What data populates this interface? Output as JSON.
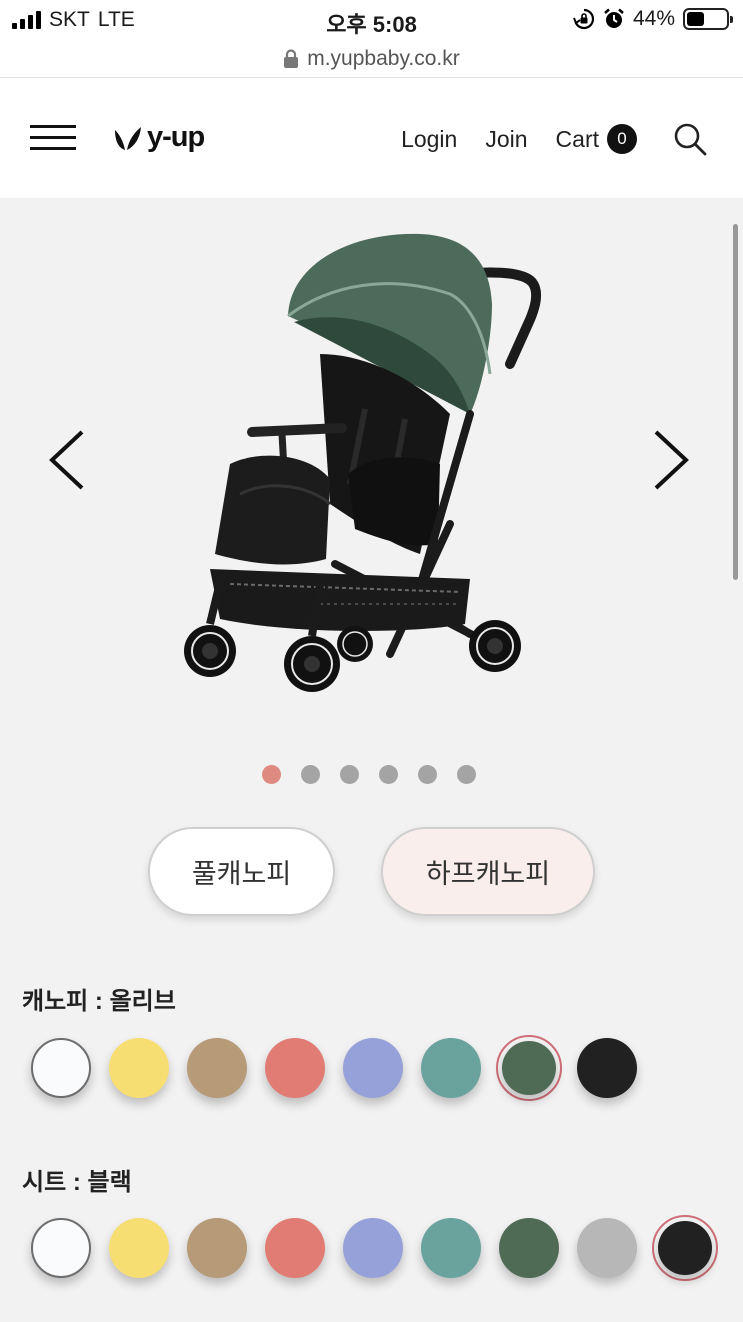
{
  "status_bar": {
    "carrier": "SKT",
    "network": "LTE",
    "time": "오후 5:08",
    "battery": "44%",
    "battery_level": 0.44
  },
  "url_bar": {
    "url": "m.yupbaby.co.kr"
  },
  "header": {
    "logo": "y-up",
    "login": "Login",
    "join": "Join",
    "cart_label": "Cart",
    "cart_count": "0"
  },
  "gallery": {
    "image": "green stroller",
    "slide_count": 6,
    "active_slide": 1,
    "colors": {
      "active_dot": "#df8a80",
      "inactive_dot": "#a4a4a4"
    }
  },
  "canopy_type": {
    "options": [
      "풀캐노피",
      "하프캐노피"
    ],
    "selected": "하프캐노피"
  },
  "canopy_color": {
    "label": "캐노피 : 올리브",
    "swatches": [
      "#fafbfd",
      "#f6de73",
      "#b79a77",
      "#e07c74",
      "#97a1d9",
      "#6aa39d",
      "#4f6b55",
      "#212121"
    ],
    "selected_index": 6
  },
  "seat_color": {
    "label": "시트 : 블랙",
    "swatches": [
      "#fafbfd",
      "#f6de73",
      "#b79a77",
      "#e07c74",
      "#97a1d9",
      "#6aa39d",
      "#4f6b55",
      "#b7b7b7",
      "#212121"
    ],
    "selected_index": 8
  }
}
